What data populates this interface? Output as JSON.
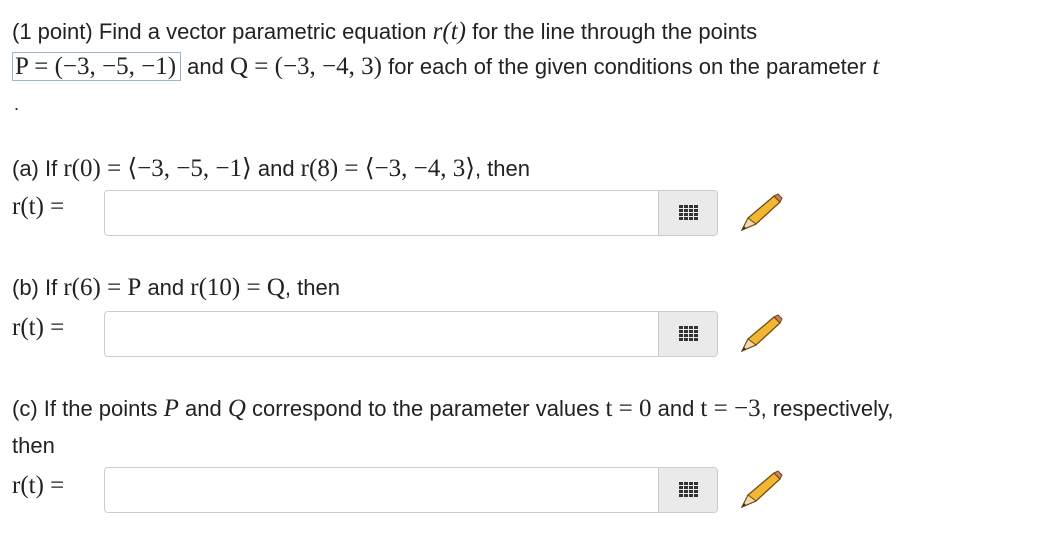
{
  "intro": {
    "prefix": "(1 point) Find a vector parametric equation ",
    "r_t": "r(t)",
    "suffix": " for the line through the points",
    "p_eq": "P = (−3, −5, −1)",
    "and": " and ",
    "q_eq": "Q = (−3, −4, 3)",
    "tail": " for each of the given conditions on the parameter ",
    "t": "t"
  },
  "dot": ".",
  "parts": [
    {
      "prefix": "(a) If ",
      "m1": "r(0) = ⟨−3, −5, −1⟩",
      "and": " and ",
      "m2": "r(8) = ⟨−3, −4, 3⟩",
      "suffix": ", then",
      "label": "r(t) =",
      "value": ""
    },
    {
      "prefix": "(b) If ",
      "m1": "r(6) = P",
      "and": " and ",
      "m2": "r(10) = Q",
      "suffix": ", then",
      "label": "r(t) =",
      "value": ""
    },
    {
      "prefix": "(c) If the points ",
      "m1": "P",
      "and": " and ",
      "m2": "Q",
      "mid": " correspond to the parameter values ",
      "m3": "t = 0",
      "and2": " and ",
      "m4": "t = −3",
      "suffix": ", respectively,",
      "line2": "then",
      "label": "r(t) =",
      "value": ""
    }
  ],
  "icons": {
    "palette": "grid-icon",
    "pencil": "pencil-icon"
  }
}
